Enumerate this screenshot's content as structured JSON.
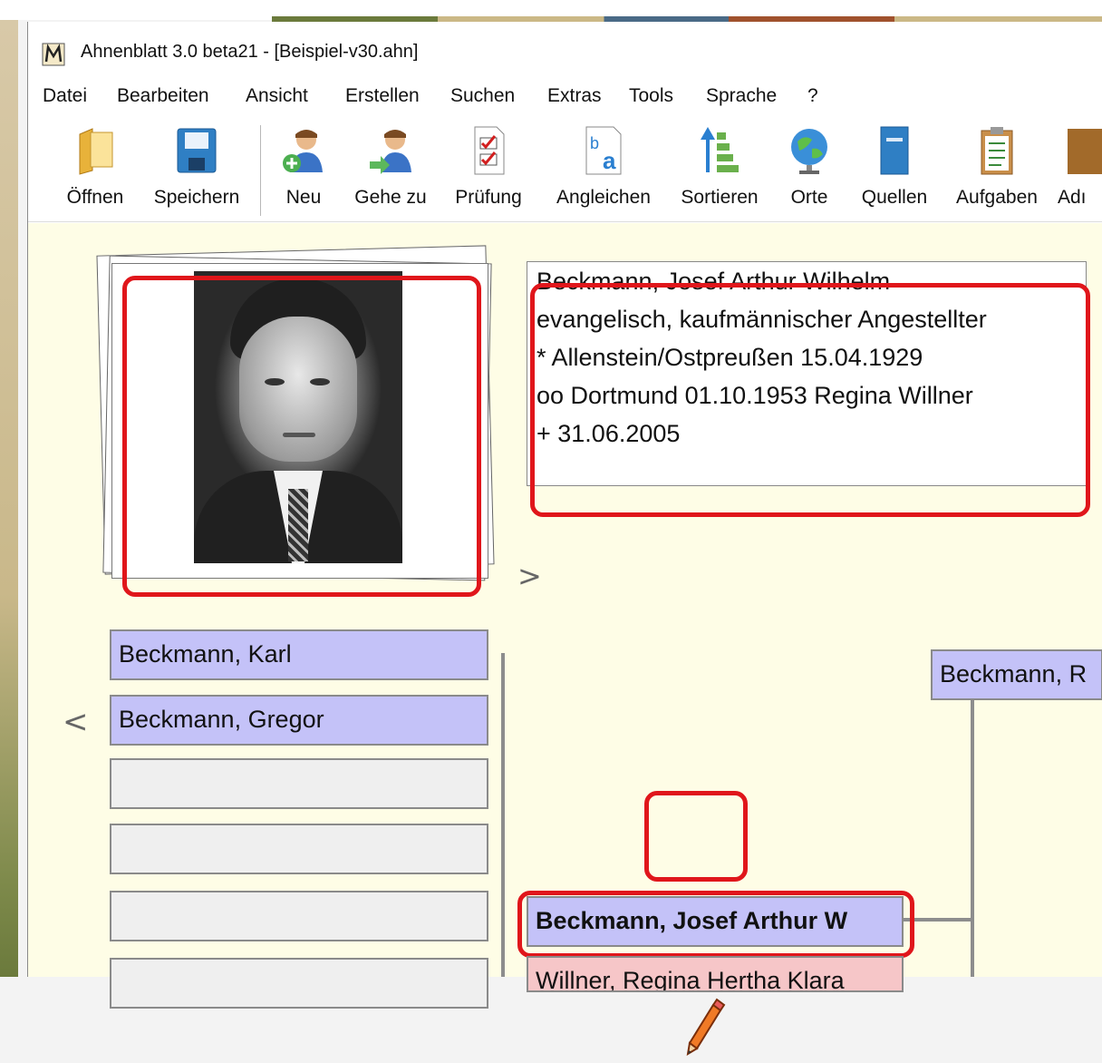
{
  "window": {
    "title": "Ahnenblatt 3.0 beta21 - [Beispiel-v30.ahn]",
    "app_icon": "ahnenblatt-logo-icon"
  },
  "menu": [
    "Datei",
    "Bearbeiten",
    "Ansicht",
    "Erstellen",
    "Suchen",
    "Extras",
    "Tools",
    "Sprache",
    "?"
  ],
  "toolbar": [
    {
      "label": "Öffnen",
      "icon": "folder-open-icon"
    },
    {
      "label": "Speichern",
      "icon": "save-disk-icon"
    },
    {
      "label": "Neu",
      "icon": "add-person-icon"
    },
    {
      "label": "Gehe zu",
      "icon": "goto-person-icon"
    },
    {
      "label": "Prüfung",
      "icon": "checklist-icon"
    },
    {
      "label": "Angleichen",
      "icon": "ba-replace-icon"
    },
    {
      "label": "Sortieren",
      "icon": "sort-icon"
    },
    {
      "label": "Orte",
      "icon": "globe-icon"
    },
    {
      "label": "Quellen",
      "icon": "book-icon"
    },
    {
      "label": "Aufgaben",
      "icon": "clipboard-tasks-icon"
    },
    {
      "label": "Adı",
      "icon": "address-book-icon"
    }
  ],
  "person_info": [
    "Beckmann, Josef Arthur Wilhelm",
    "evangelisch, kaufmännischer Angestellter",
    "* Allenstein/Ostpreußen 15.04.1929",
    "oo Dortmund 01.10.1953 Regina Willner",
    "+ 31.06.2005"
  ],
  "nav": {
    "next": ">",
    "prev": "<"
  },
  "siblings": [
    {
      "name": "Beckmann, Karl",
      "sex": "male"
    },
    {
      "name": "Beckmann, Gregor",
      "sex": "male"
    },
    {
      "name": "",
      "sex": "empty"
    },
    {
      "name": "",
      "sex": "empty"
    },
    {
      "name": "",
      "sex": "empty"
    },
    {
      "name": "",
      "sex": "empty"
    }
  ],
  "main_person": "Beckmann, Josef Arthur W",
  "spouse": "Willner, Regina Hertha Klara",
  "father": "Beckmann, R",
  "colors": {
    "male": "#c4c2f8",
    "female": "#f6c6c8",
    "empty": "#efefef",
    "highlight": "#e0161b",
    "background": "#fefde6"
  }
}
